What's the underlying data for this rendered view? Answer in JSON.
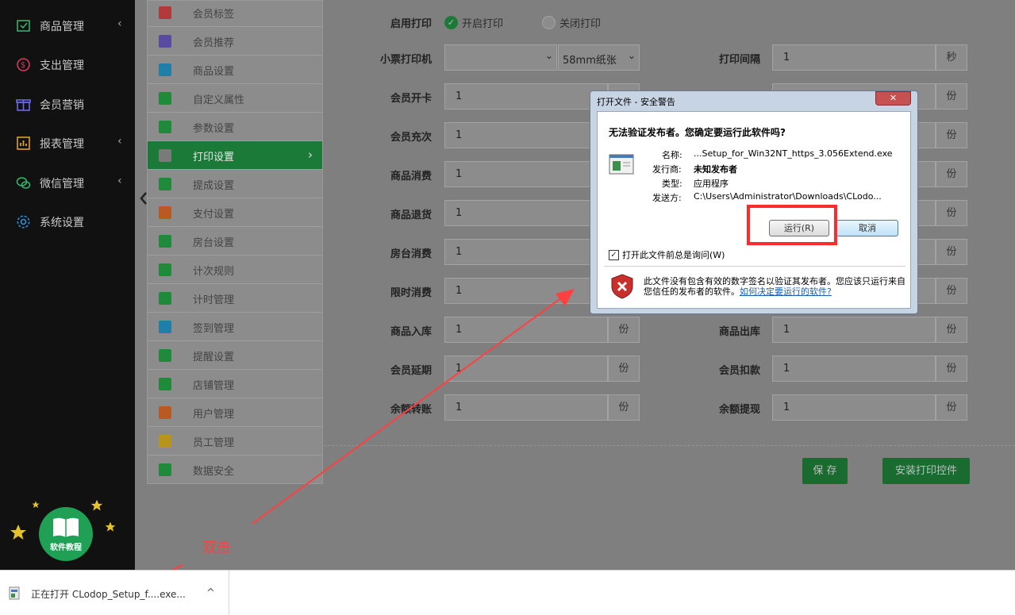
{
  "sidebar": {
    "items": [
      {
        "label": "商品管理",
        "icon": "product-icon",
        "chevron": "‹"
      },
      {
        "label": "支出管理",
        "icon": "expense-icon",
        "chevron": ""
      },
      {
        "label": "会员营销",
        "icon": "gift-icon",
        "chevron": ""
      },
      {
        "label": "报表管理",
        "icon": "report-icon",
        "chevron": "‹"
      },
      {
        "label": "微信管理",
        "icon": "wechat-icon",
        "chevron": "‹"
      },
      {
        "label": "系统设置",
        "icon": "gear-icon",
        "chevron": ""
      }
    ],
    "tutorial_label": "软件教程"
  },
  "submenu": {
    "items": [
      {
        "label": "会员标签",
        "color": "#b23a3a"
      },
      {
        "label": "会员推荐",
        "color": "#5a4aa0"
      },
      {
        "label": "商品设置",
        "color": "#1f7fa8"
      },
      {
        "label": "自定义属性",
        "color": "#1f8a3a"
      },
      {
        "label": "参数设置",
        "color": "#1f8a3a"
      },
      {
        "label": "打印设置",
        "color": "#7a7a7a"
      },
      {
        "label": "提成设置",
        "color": "#1f8a3a"
      },
      {
        "label": "支付设置",
        "color": "#b85a22"
      },
      {
        "label": "房台设置",
        "color": "#1f8a3a"
      },
      {
        "label": "计次规则",
        "color": "#1f8a3a"
      },
      {
        "label": "计时管理",
        "color": "#1f8a3a"
      },
      {
        "label": "签到管理",
        "color": "#1f7fa8"
      },
      {
        "label": "提醒设置",
        "color": "#1f8a3a"
      },
      {
        "label": "店铺管理",
        "color": "#1f8a3a"
      },
      {
        "label": "用户管理",
        "color": "#b85a22"
      },
      {
        "label": "员工管理",
        "color": "#b8941c"
      },
      {
        "label": "数据安全",
        "color": "#1f8a3a"
      }
    ],
    "active_arrow": "›"
  },
  "print_settings": {
    "enable_print_label": "启用打印",
    "enable_on": "开启打印",
    "enable_off": "关闭打印",
    "printer_label": "小票打印机",
    "printer_value": "",
    "paper_value": "58mm纸张",
    "interval_label": "打印间隔",
    "interval_value": "1",
    "interval_unit": "秒",
    "unit": "份",
    "left_fields": [
      {
        "label": "会员开卡",
        "value": "1"
      },
      {
        "label": "会员充次",
        "value": "1"
      },
      {
        "label": "商品消费",
        "value": "1"
      },
      {
        "label": "商品退货",
        "value": "1"
      },
      {
        "label": "房台消费",
        "value": "1"
      },
      {
        "label": "限时消费",
        "value": "1"
      },
      {
        "label": "商品入库",
        "value": "1"
      },
      {
        "label": "会员延期",
        "value": "1"
      },
      {
        "label": "余额转账",
        "value": "1"
      }
    ],
    "right_fields": [
      {
        "label": "",
        "value": "1"
      },
      {
        "label": "",
        "value": "1"
      },
      {
        "label": "",
        "value": "1"
      },
      {
        "label": "",
        "value": "1"
      },
      {
        "label": "",
        "value": "1"
      },
      {
        "label": "",
        "value": "1"
      },
      {
        "label": "商品出库",
        "value": "1"
      },
      {
        "label": "会员扣款",
        "value": "1"
      },
      {
        "label": "余额提现",
        "value": "1"
      }
    ],
    "save_button": "保 存",
    "install_button": "安装打印控件"
  },
  "dialog": {
    "title": "打开文件 - 安全警告",
    "heading": "无法验证发布者。您确定要运行此软件吗?",
    "name_label": "名称:",
    "name_value": "...Setup_for_Win32NT_https_3.056Extend.exe",
    "publisher_label": "发行商:",
    "publisher_value": "未知发布者",
    "type_label": "类型:",
    "type_value": "应用程序",
    "from_label": "发送方:",
    "from_value": "C:\\Users\\Administrator\\Downloads\\CLodo...",
    "run_button": "运行(R)",
    "cancel_button": "取消",
    "ask_checkbox": "打开此文件前总是询问(W)",
    "warning_text": "此文件没有包含有效的数字签名以验证其发布者。您应该只运行来自您信任的发布者的软件。",
    "warning_link": "如何决定要运行的软件?",
    "close_glyph": "✕"
  },
  "annotation": {
    "text": "双击"
  },
  "download_bar": {
    "item_text": "正在打开 CLodop_Setup_f....exe...",
    "chevron": "^"
  },
  "colors": {
    "sidebar_bg": "#111111",
    "accent_green": "#1c7a38",
    "annotation_red": "#ff4040",
    "highlight_red": "#ff2a2a"
  }
}
